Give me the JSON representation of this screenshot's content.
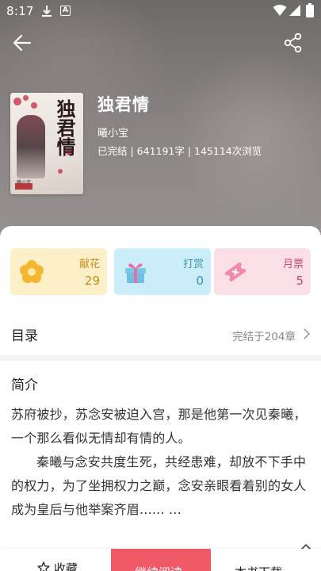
{
  "status_bar": {
    "time": "8:17",
    "download_icon": "download-icon",
    "a_badge": "A",
    "wifi_icon": "wifi-icon",
    "signal_icon": "signal-icon",
    "battery_icon": "battery-icon"
  },
  "header": {
    "back_icon": "arrow-left-icon",
    "share_icon": "share-icon"
  },
  "book": {
    "title": "独君情",
    "author": "曦小宝",
    "meta": "已完结 | 641191字 | 145114次浏览",
    "cover_title": "独君情"
  },
  "stats": [
    {
      "label": "献花",
      "value": "29",
      "icon": "flower-icon",
      "color": "#c98a17"
    },
    {
      "label": "打赏",
      "value": "0",
      "icon": "gift-icon",
      "color": "#3c91b0"
    },
    {
      "label": "月票",
      "value": "5",
      "icon": "ticket-icon",
      "color": "#cb4c6d"
    }
  ],
  "toc": {
    "title": "目录",
    "status": "完结于204章"
  },
  "intro": {
    "title": "简介",
    "paragraphs": [
      "苏府被抄，苏念安被迫入宫，那是他第一次见秦曦，一个那么看似无情却有情的人。",
      "秦曦与念安共度生死，共经患难，却放不下手中的权力，为了坐拥权力之巅，念安亲眼看着别的女人成为皇后与他举案齐眉...... ..."
    ]
  },
  "bottom_bar": {
    "favorite_label": "收藏",
    "read_label": "继续阅读",
    "download_label": "本书下载",
    "accent_color": "#f05a66"
  }
}
